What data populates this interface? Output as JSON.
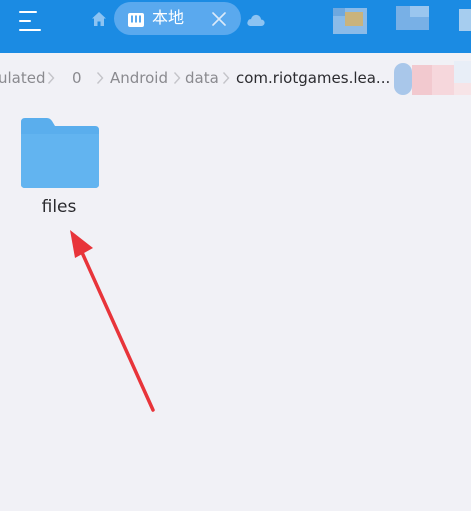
{
  "header": {
    "tab": {
      "icon": "storage-icon",
      "label": "本地"
    },
    "icons": {
      "menu": "menu-icon",
      "home": "home-icon",
      "close": "close-icon",
      "cloud": "cloud-icon"
    },
    "colors": {
      "bar": "#1b8be3",
      "tab_pill": "#5aa9ee",
      "icon": "#ffffff"
    }
  },
  "breadcrumb": {
    "items": [
      {
        "label": "ulated"
      },
      {
        "label": "0"
      },
      {
        "label": "Android"
      },
      {
        "label": "data"
      },
      {
        "label": "com.riotgames.lea..."
      }
    ],
    "separator_icon": "chevron-right-icon"
  },
  "files": [
    {
      "name": "files",
      "type": "folder",
      "icon": "folder-icon",
      "color": "#5aaeed"
    }
  ],
  "annotation": {
    "type": "arrow",
    "color": "#e8343a",
    "points_to": "files"
  }
}
